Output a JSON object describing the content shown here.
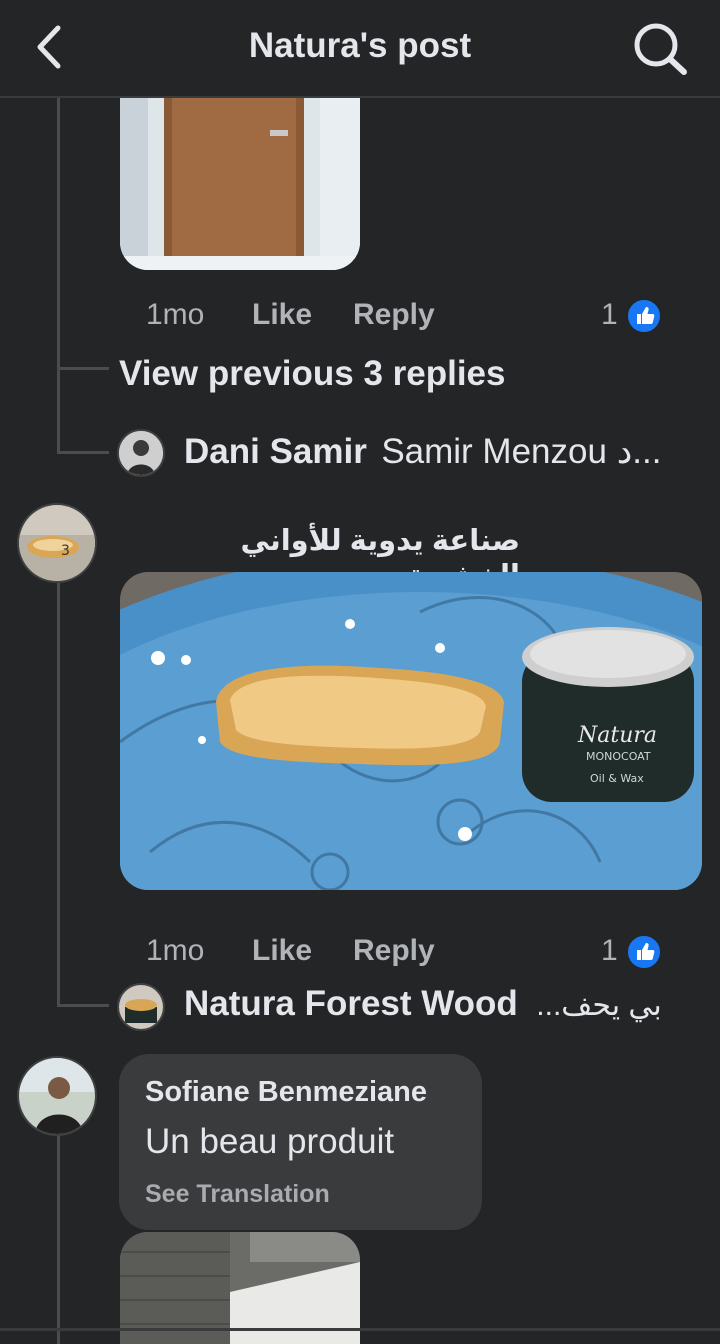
{
  "header": {
    "title": "Natura's post"
  },
  "comment1": {
    "time": "1mo",
    "like": "Like",
    "reply": "Reply",
    "reactions": "1"
  },
  "view_previous": "View previous 3 replies",
  "reply1": {
    "author": "Dani Samir",
    "preview": "Samir Menzou د..."
  },
  "comment2": {
    "author": "صناعة يدوية للأواني الخشبية",
    "time": "1mo",
    "like": "Like",
    "reply": "Reply",
    "reactions": "1"
  },
  "reply2": {
    "author": "Natura Forest Wood",
    "preview": "بي يحف..."
  },
  "comment3": {
    "author": "Sofiane Benmeziane",
    "text": "Un beau produit",
    "translate": "See Translation"
  },
  "colors": {
    "background": "#242526",
    "accent": "#1877f2",
    "bubble": "#3a3b3c"
  },
  "icons": [
    "back-icon",
    "search-icon",
    "like-thumb-icon"
  ]
}
